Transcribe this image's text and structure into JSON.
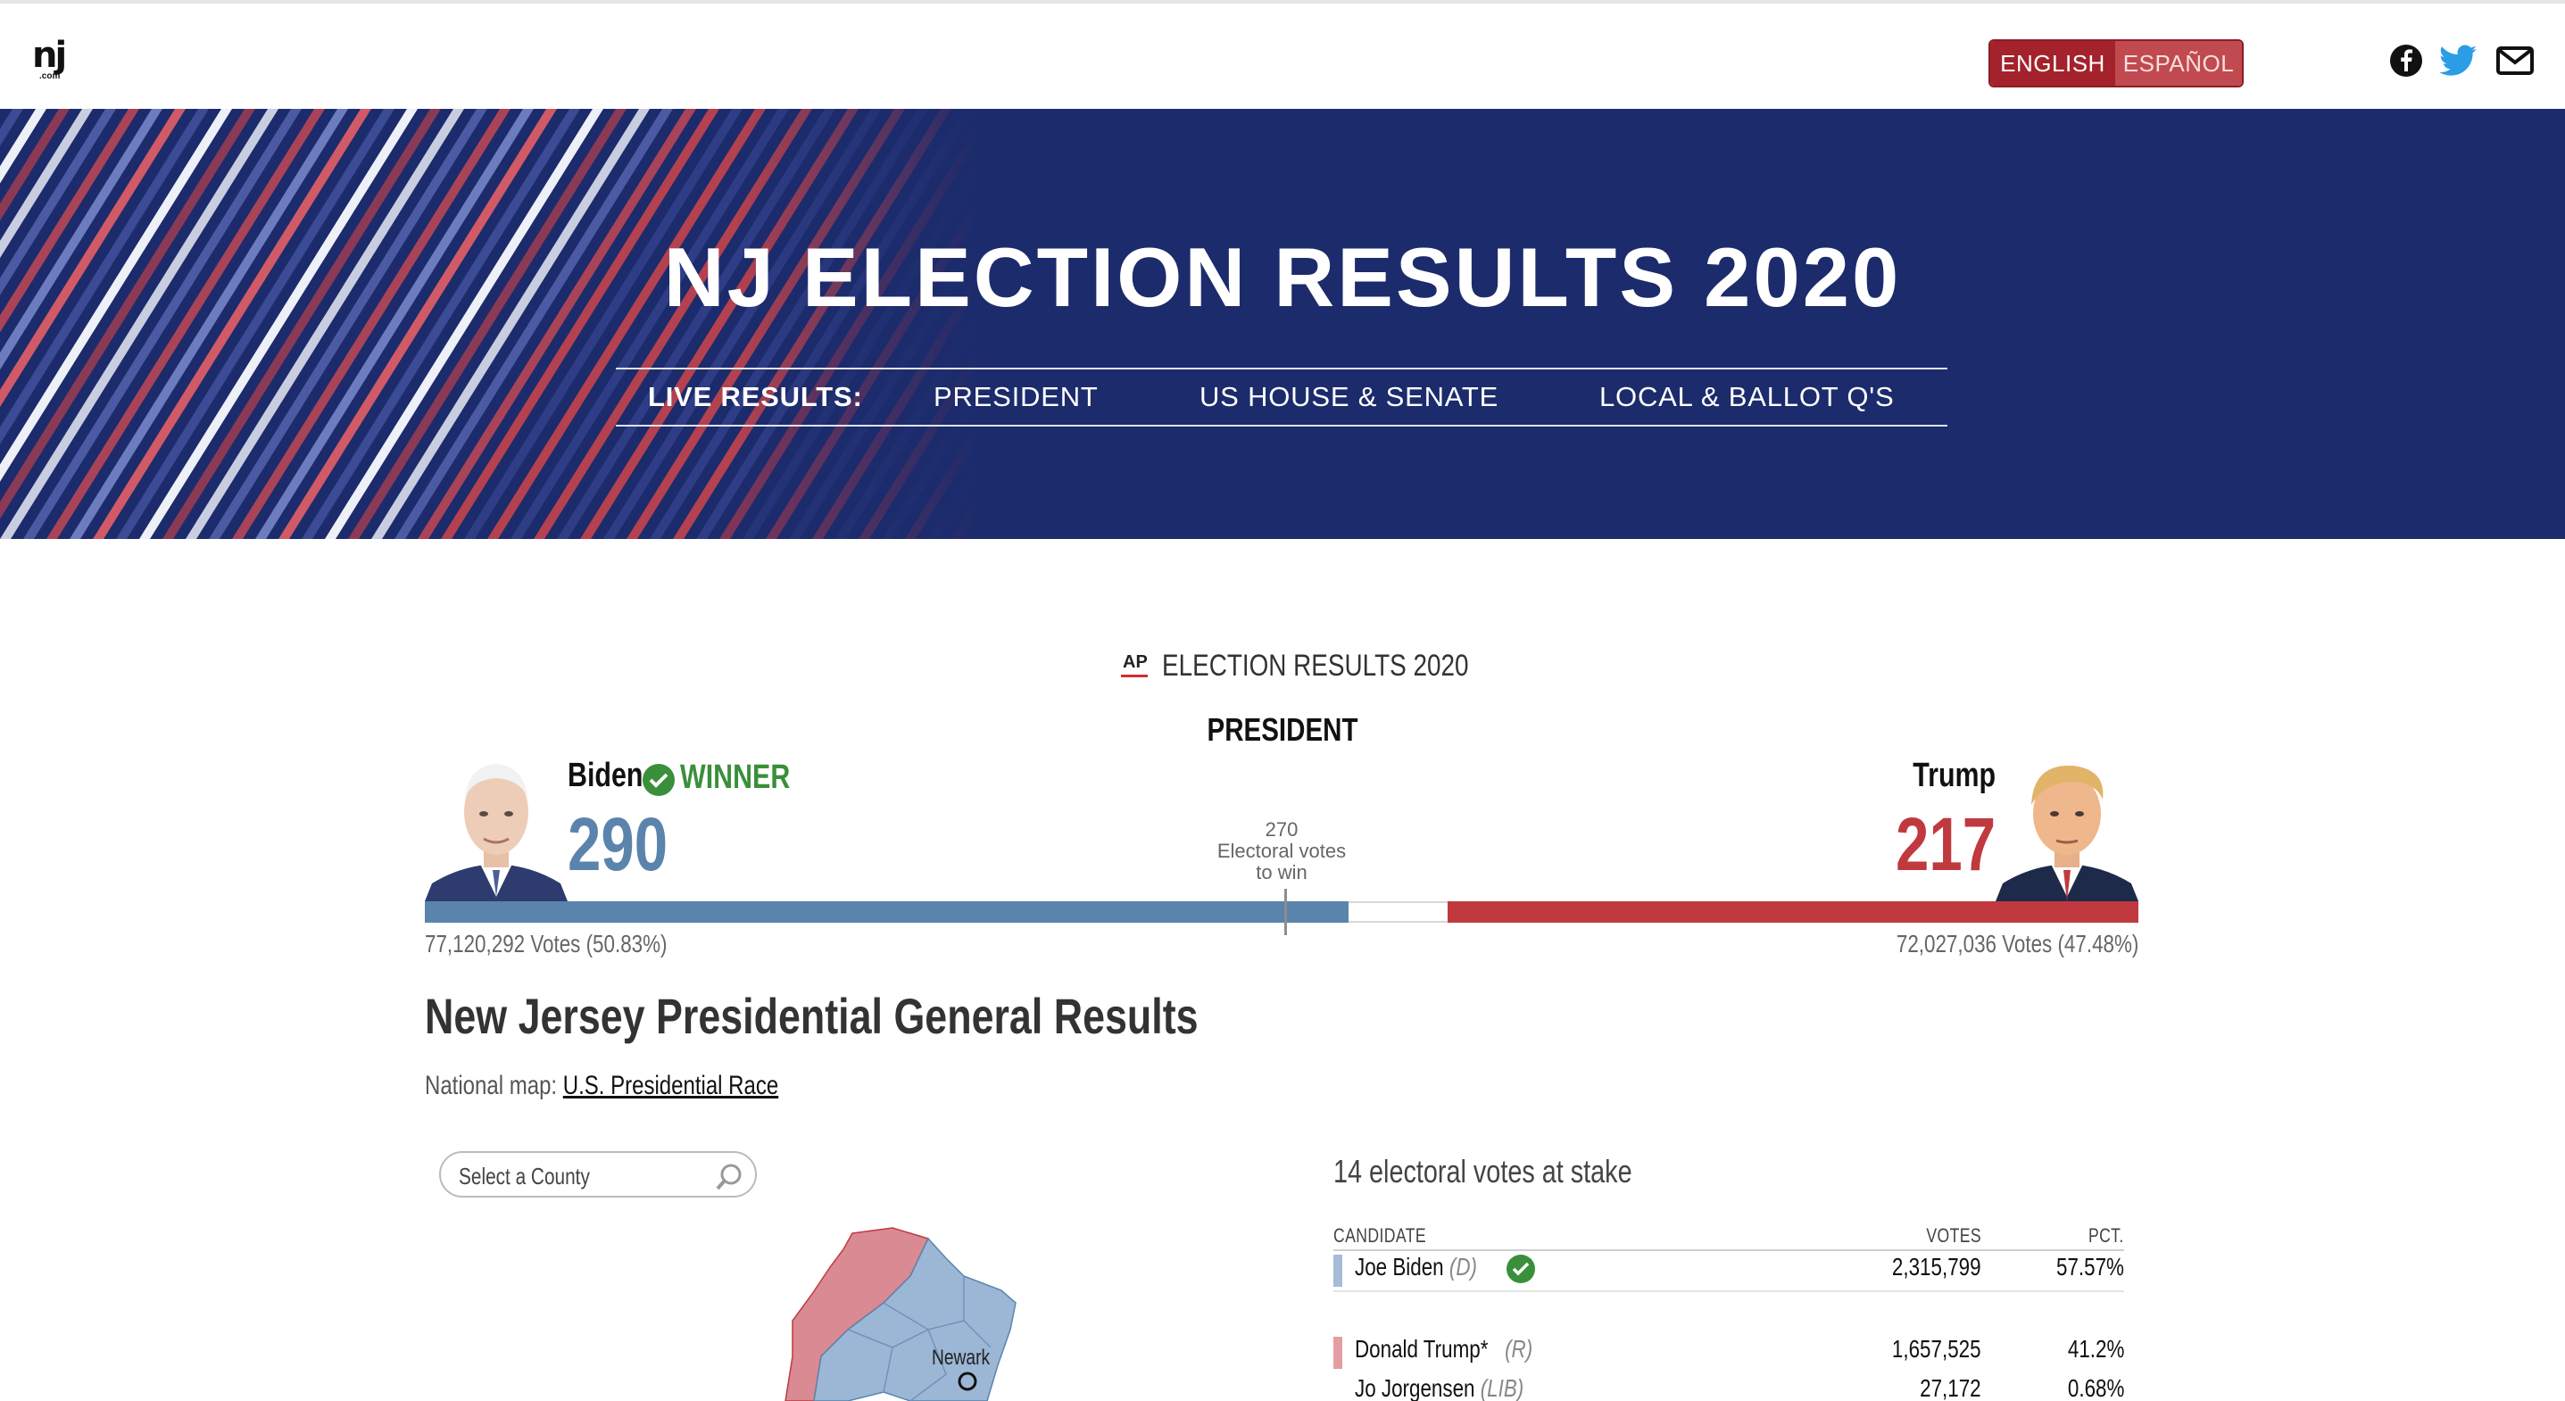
{
  "site": {
    "logo_text": "nj",
    "logo_sub": ".com",
    "lang": {
      "english": "ENGLISH",
      "spanish": "ESPAÑOL"
    },
    "social_icons": [
      "facebook-icon",
      "twitter-icon",
      "mail-icon"
    ]
  },
  "hero": {
    "title": "NJ ELECTION RESULTS 2020",
    "nav": {
      "live": "LIVE RESULTS:",
      "president": "PRESIDENT",
      "house_senate": "US HOUSE & SENATE",
      "local": "LOCAL & BALLOT Q'S"
    }
  },
  "ap": {
    "logo": "AP",
    "title": "ELECTION RESULTS 2020",
    "race": "PRESIDENT"
  },
  "candidates": {
    "biden": {
      "name": "Biden",
      "status": "WINNER",
      "electoral": "290",
      "votes": "77,120,292 Votes (50.83%)",
      "color": "#5b84ad"
    },
    "trump": {
      "name": "Trump",
      "electoral": "217",
      "votes": "72,027,036 Votes (47.48%)",
      "color": "#c0393f"
    },
    "to_win": {
      "number": "270",
      "line1": "Electoral votes",
      "line2": "to win"
    }
  },
  "electoral_bar": {
    "total": 538,
    "biden": 290,
    "trump": 217,
    "threshold": 270
  },
  "section": {
    "title": "New Jersey Presidential General Results",
    "natmap_label": "National map:",
    "natmap_link": "U.S. Presidential Race"
  },
  "county_search": {
    "placeholder": "Select a County"
  },
  "map": {
    "city_label": "Newark"
  },
  "results": {
    "stake": "14 electoral votes at stake",
    "headers": {
      "candidate": "CANDIDATE",
      "votes": "VOTES",
      "pct": "PCT."
    },
    "rows": [
      {
        "name": "Joe Biden",
        "party": "(D)",
        "votes": "2,315,799",
        "pct": "57.57%",
        "color": "#a6bcd6"
      },
      {
        "name": "Donald Trump*",
        "party": "(R)",
        "votes": "1,657,525",
        "pct": "41.2%",
        "color": "#e29ea2"
      },
      {
        "name": "Jo Jorgensen",
        "party": "(LIB)",
        "votes": "27,172",
        "pct": "0.68%",
        "color": "#cccccc"
      }
    ]
  }
}
